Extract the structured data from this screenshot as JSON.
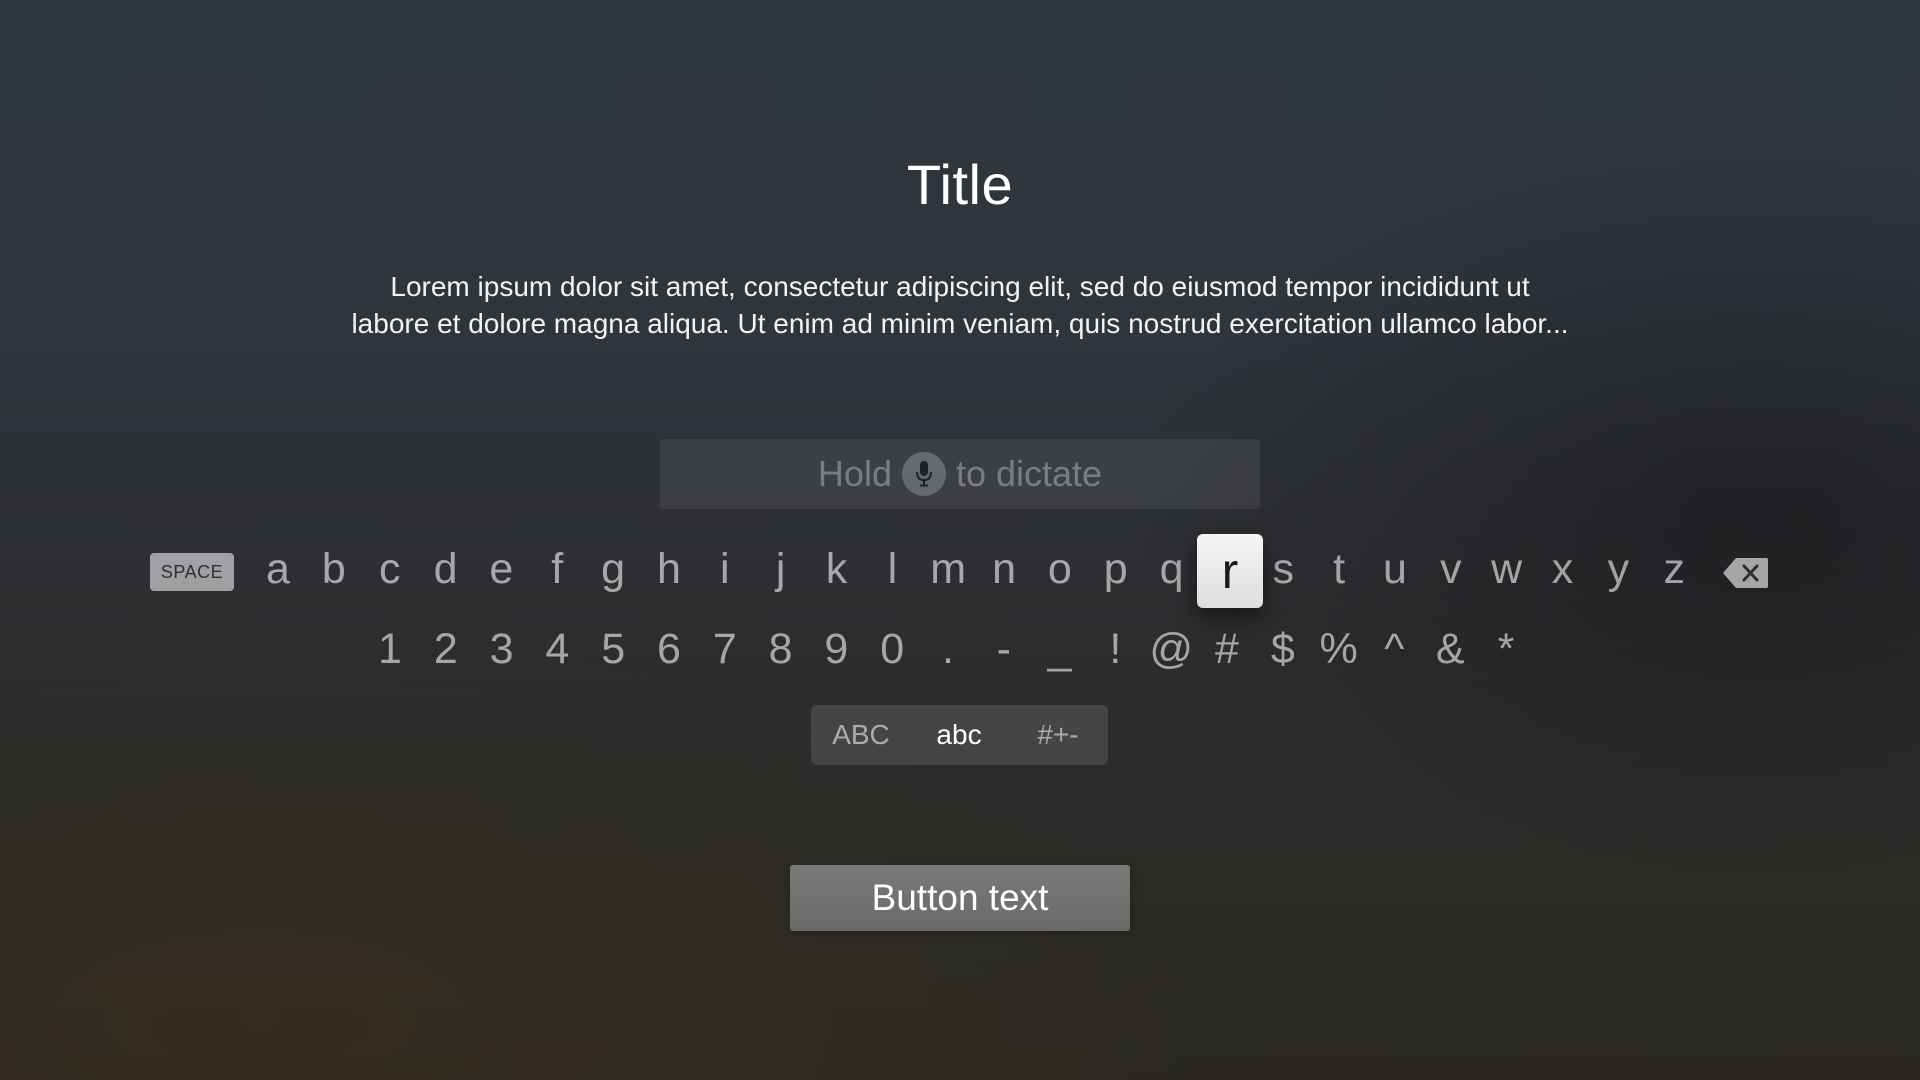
{
  "title": "Title",
  "description": {
    "line1": "Lorem ipsum dolor sit amet, consectetur adipiscing elit, sed do eiusmod tempor incididunt ut",
    "line2": "labore et dolore magna aliqua. Ut enim ad minim veniam, quis nostrud exercitation ullamco labor..."
  },
  "dictation": {
    "prefix": "Hold",
    "suffix": "to dictate",
    "icon": "microphone-icon"
  },
  "keyboard": {
    "space_label": "SPACE",
    "delete_icon": "delete-backspace-icon",
    "focused_key": "r",
    "letters": [
      "a",
      "b",
      "c",
      "d",
      "e",
      "f",
      "g",
      "h",
      "i",
      "j",
      "k",
      "l",
      "m",
      "n",
      "o",
      "p",
      "q",
      "r",
      "s",
      "t",
      "u",
      "v",
      "w",
      "x",
      "y",
      "z"
    ],
    "symbols": [
      "1",
      "2",
      "3",
      "4",
      "5",
      "6",
      "7",
      "8",
      "9",
      "0",
      ".",
      "-",
      "_",
      "!",
      "@",
      "#",
      "$",
      "%",
      "^",
      "&",
      "*"
    ]
  },
  "mode_selector": {
    "options": [
      "ABC",
      "abc",
      "#+-"
    ],
    "selected": "abc"
  },
  "primary_button": {
    "label": "Button text"
  },
  "colors": {
    "focused_key_background": "#f0f0f0",
    "button_background": "#737270"
  }
}
